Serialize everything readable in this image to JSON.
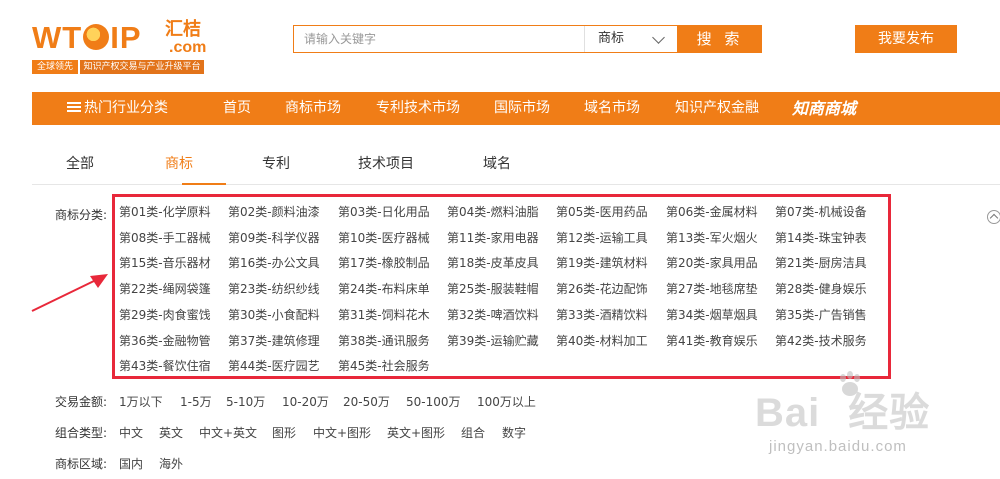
{
  "header": {
    "logo": {
      "main": "WT",
      "main_end": "IP",
      "cn": "汇桔",
      "com": ".com",
      "tag1": "全球领先",
      "tag2": "知识产权交易与产业升级平台"
    },
    "search": {
      "placeholder": "请输入关键字",
      "select_value": "商标",
      "button_label": "搜 索"
    },
    "publish_label": "我要发布"
  },
  "nav": {
    "items": [
      "热门行业分类",
      "首页",
      "商标市场",
      "专利技术市场",
      "国际市场",
      "域名市场",
      "知识产权金融",
      "知商商城"
    ]
  },
  "tabs": {
    "items": [
      "全部",
      "商标",
      "专利",
      "技术项目",
      "域名"
    ],
    "active": "商标"
  },
  "filters": {
    "category_label": "商标分类:",
    "categories": [
      "第01类-化学原料",
      "第02类-颜料油漆",
      "第03类-日化用品",
      "第04类-燃料油脂",
      "第05类-医用药品",
      "第06类-金属材料",
      "第07类-机械设备",
      "第08类-手工器械",
      "第09类-科学仪器",
      "第10类-医疗器械",
      "第11类-家用电器",
      "第12类-运输工具",
      "第13类-军火烟火",
      "第14类-珠宝钟表",
      "第15类-音乐器材",
      "第16类-办公文具",
      "第17类-橡胶制品",
      "第18类-皮革皮具",
      "第19类-建筑材料",
      "第20类-家具用品",
      "第21类-厨房洁具",
      "第22类-绳网袋篷",
      "第23类-纺织纱线",
      "第24类-布料床单",
      "第25类-服装鞋帽",
      "第26类-花边配饰",
      "第27类-地毯席垫",
      "第28类-健身娱乐",
      "第29类-肉食蜜饯",
      "第30类-小食配料",
      "第31类-饲料花木",
      "第32类-啤酒饮料",
      "第33类-酒精饮料",
      "第34类-烟草烟具",
      "第35类-广告销售",
      "第36类-金融物管",
      "第37类-建筑修理",
      "第38类-通讯服务",
      "第39类-运输贮藏",
      "第40类-材料加工",
      "第41类-教育娱乐",
      "第42类-技术服务",
      "第43类-餐饮住宿",
      "第44类-医疗园艺",
      "第45类-社会服务"
    ],
    "amount": {
      "label": "交易金额:",
      "options": [
        "1万以下",
        "1-5万",
        "5-10万",
        "10-20万",
        "20-50万",
        "50-100万",
        "100万以上"
      ]
    },
    "combo": {
      "label": "组合类型:",
      "options": [
        "中文",
        "英文",
        "中文+英文",
        "图形",
        "中文+图形",
        "英文+图形",
        "组合",
        "数字"
      ]
    },
    "region": {
      "label": "商标区域:",
      "options": [
        "国内",
        "海外"
      ]
    }
  },
  "watermark": {
    "main": "Bai",
    "main_end": "经验",
    "sub": "jingyan.baidu.com"
  },
  "colors": {
    "brand": "#f07d17",
    "highlight": "#e8283a"
  }
}
